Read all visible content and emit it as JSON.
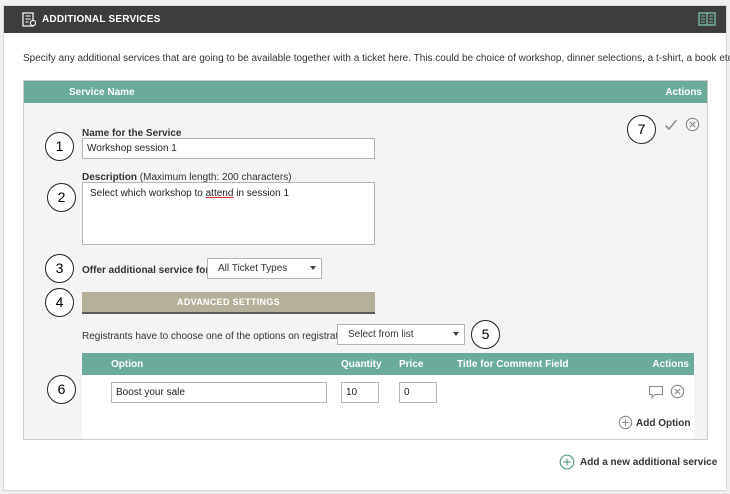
{
  "header": {
    "title": "ADDITIONAL SERVICES"
  },
  "intro_text": "Specify any additional services that are going to be available together with a ticket here. This could be choice of workshop, dinner selections, a t-shirt, a book etc.",
  "services_table": {
    "col_name": "Service Name",
    "col_actions": "Actions"
  },
  "service_form": {
    "name_label": "Name for the Service",
    "name_value": "Workshop session 1",
    "description_label": "Description",
    "description_note": "(Maximum length: 200 characters)",
    "description_value_pre": "Select which workshop to ",
    "description_value_underlined": "attend",
    "description_value_post": " in session 1",
    "offer_label": "Offer additional service for:",
    "offer_selected": "All Ticket Types",
    "advanced_button": "ADVANCED SETTINGS",
    "registrants_text": "Registrants have to choose one of the options on registration:",
    "registrants_selected": "Select from list"
  },
  "options_table": {
    "col_option": "Option",
    "col_quantity": "Quantity",
    "col_price": "Price",
    "col_comment": "Title for Comment Field",
    "col_actions": "Actions",
    "rows": [
      {
        "option": "Boost your sale",
        "quantity": "10",
        "price": "0"
      }
    ],
    "add_option_label": "Add Option"
  },
  "add_service_label": "Add a new additional service",
  "badges": [
    "1",
    "2",
    "3",
    "4",
    "5",
    "6",
    "7"
  ],
  "colors": {
    "header_bg": "#3d3d3d",
    "table_head": "#6aab9b",
    "advanced_btn": "#b5b099",
    "accent_green": "#5a9e8b"
  }
}
